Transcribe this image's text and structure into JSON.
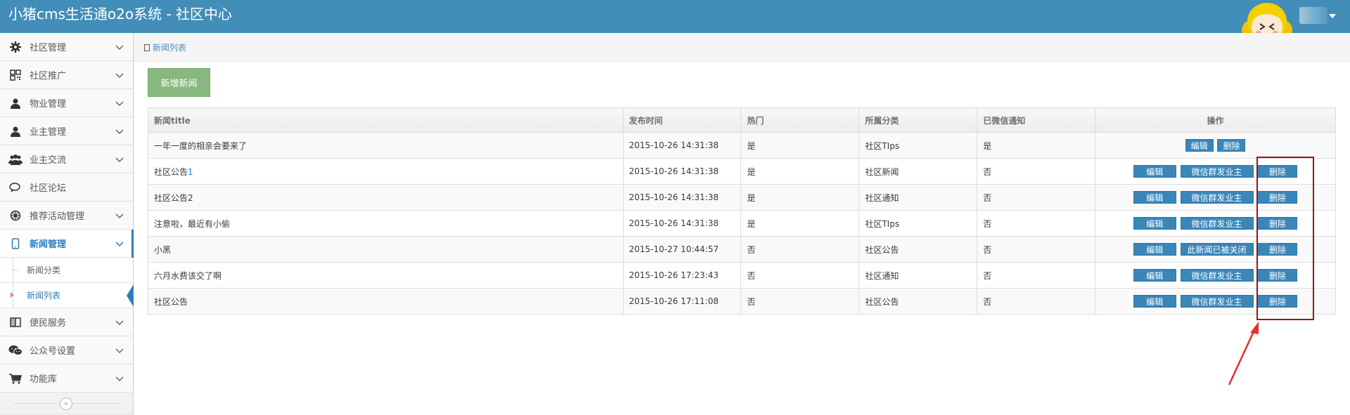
{
  "header": {
    "title": "小猪cms生活通o2o系统 - 社区中心"
  },
  "sidebar": {
    "items": [
      {
        "label": "社区管理",
        "icon": "gear-icon"
      },
      {
        "label": "社区推广",
        "icon": "qrcode-icon"
      },
      {
        "label": "物业管理",
        "icon": "user-icon"
      },
      {
        "label": "业主管理",
        "icon": "user-icon"
      },
      {
        "label": "业主交流",
        "icon": "users-icon"
      },
      {
        "label": "社区论坛",
        "icon": "comments-icon"
      },
      {
        "label": "推荐活动管理",
        "icon": "dharma-wheel-icon"
      },
      {
        "label": "新闻管理",
        "icon": "mobile-icon"
      },
      {
        "label": "便民服务",
        "icon": "columns-icon"
      },
      {
        "label": "公众号设置",
        "icon": "wechat-icon"
      },
      {
        "label": "功能库",
        "icon": "cart-icon"
      }
    ],
    "subitems": [
      {
        "label": "新闻分类"
      },
      {
        "label": "新闻列表"
      }
    ],
    "collapse_glyph": "«"
  },
  "breadcrumb": {
    "label": "新闻列表"
  },
  "toolbar": {
    "add_label": "新增新闻"
  },
  "table": {
    "columns": [
      "新闻title",
      "发布时间",
      "热门",
      "所属分类",
      "已微信通知",
      "操作"
    ],
    "rows": [
      {
        "title": "一年一度的相亲会要来了",
        "num": "",
        "time": "2015-10-26 14:31:38",
        "hot": "是",
        "category": "社区TIps",
        "notified": "是",
        "wx": ""
      },
      {
        "title": "社区公告",
        "num": "1",
        "time": "2015-10-26 14:31:38",
        "hot": "是",
        "category": "社区新闻",
        "notified": "否",
        "wx": "微信群发业主"
      },
      {
        "title": "社区公告2",
        "num": "",
        "time": "2015-10-26 14:31:38",
        "hot": "是",
        "category": "社区通知",
        "notified": "否",
        "wx": "微信群发业主"
      },
      {
        "title": "注意啦，最近有小偷",
        "num": "",
        "time": "2015-10-26 14:31:38",
        "hot": "是",
        "category": "社区TIps",
        "notified": "否",
        "wx": "微信群发业主"
      },
      {
        "title": "小黑",
        "num": "",
        "time": "2015-10-27 10:44:57",
        "hot": "否",
        "category": "社区公告",
        "notified": "否",
        "wx": "此新闻已被关闭"
      },
      {
        "title": "六月水费该交了啊",
        "num": "",
        "time": "2015-10-26 17:23:43",
        "hot": "否",
        "category": "社区通知",
        "notified": "否",
        "wx": "微信群发业主"
      },
      {
        "title": "社区公告",
        "num": "",
        "time": "2015-10-26 17:11:08",
        "hot": "否",
        "category": "社区公告",
        "notified": "否",
        "wx": "微信群发业主"
      }
    ],
    "edit_label": "编辑",
    "delete_label": "删除"
  },
  "colors": {
    "navbar": "#438eb9",
    "add_button": "#87b87f",
    "op_button": "#3a86b9",
    "highlight_box": "#8b1a1a",
    "arrow": "#e0312a"
  }
}
